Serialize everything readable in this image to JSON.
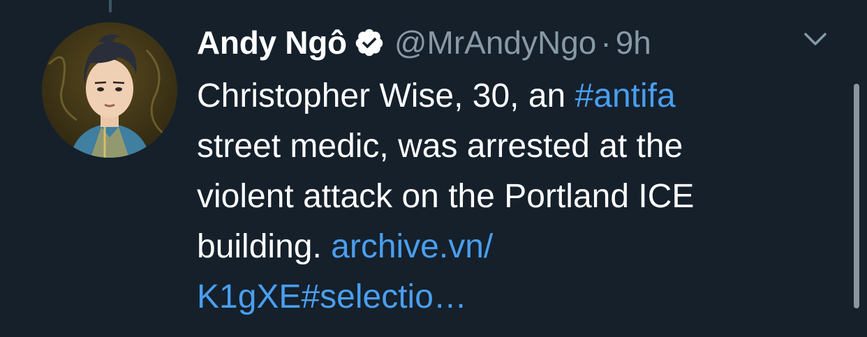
{
  "tweet": {
    "author": {
      "display_name": "Andy Ngô",
      "handle": "@MrAndyNgo",
      "verified": true,
      "avatar_icon": "profile-avatar"
    },
    "separator": "·",
    "timestamp": "9h",
    "text_lines": [
      [
        {
          "text": "Christopher Wise, 30, an ",
          "type": "text"
        },
        {
          "text": "#antifa",
          "type": "hashtag"
        }
      ],
      [
        {
          "text": "street medic, was arrested at the",
          "type": "text"
        }
      ],
      [
        {
          "text": "violent attack on the Portland ICE",
          "type": "text"
        }
      ],
      [
        {
          "text": "building. ",
          "type": "text"
        },
        {
          "text": "archive.vn/",
          "type": "link"
        }
      ],
      [
        {
          "text": "K1gXE#selectio…",
          "type": "link"
        }
      ]
    ],
    "menu_icon": "chevron-down-icon"
  },
  "colors": {
    "background": "#15202b",
    "primary_text": "#ffffff",
    "secondary_text": "#8899a6",
    "link": "#4a9eee"
  }
}
